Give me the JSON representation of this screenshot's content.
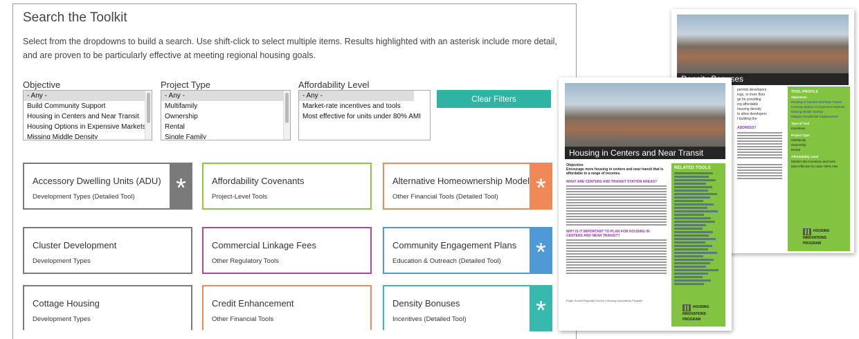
{
  "title": "Search the Toolkit",
  "intro": "Select from the dropdowns to build a search. Use shift-click to select multiple items. Results highlighted with an asterisk include more detail, and are proven to be particularly effective at meeting regional housing goals.",
  "filters": [
    {
      "label": "Objective",
      "options": [
        "- Any -",
        "Build Community Support",
        "Housing in Centers and Near Transit",
        "Housing Options in Expensive Markets",
        "Missing Middle Density"
      ]
    },
    {
      "label": "Project Type",
      "options": [
        "- Any -",
        "Multifamily",
        "Ownership",
        "Rental",
        "Single Family"
      ]
    },
    {
      "label": "Affordability Level",
      "options": [
        "- Any -",
        "Market-rate incentives and tools",
        "Most effective for units under 80% AMI"
      ]
    }
  ],
  "clear_label": "Clear Filters",
  "star_glyph": "*",
  "cards": [
    {
      "title": "Accessory Dwelling Units (ADU)",
      "subtitle": "Development Types (Detailed Tool)",
      "color": "#7a7a7a",
      "starred": true
    },
    {
      "title": "Affordability Covenants",
      "subtitle": "Project-Level Tools",
      "color": "#8dc641",
      "starred": false
    },
    {
      "title": "Alternative Homeownership Models",
      "subtitle": "Other Financial Tools (Detailed Tool)",
      "color": "#f08858",
      "starred": true
    },
    {
      "title": "Cluster Development",
      "subtitle": "Development Types",
      "color": "#7a7a7a",
      "starred": false
    },
    {
      "title": "Commercial Linkage Fees",
      "subtitle": "Other Regulatory Tools",
      "color": "#a44aa0",
      "starred": false
    },
    {
      "title": "Community Engagement Plans",
      "subtitle": "Education & Outreach (Detailed Tool)",
      "color": "#4f9ad6",
      "starred": true
    },
    {
      "title": "Cottage Housing",
      "subtitle": "Development Types",
      "color": "#7a7a7a",
      "starred": false
    },
    {
      "title": "Credit Enhancement",
      "subtitle": "Other Financial Tools",
      "color": "#f08858",
      "starred": false
    },
    {
      "title": "Density Bonuses",
      "subtitle": "Incentives (Detailed Tool)",
      "color": "#39b9ad",
      "starred": true
    }
  ],
  "doc_back": {
    "banner": "Density Bonuses",
    "profile_title": "TOOL PROFILE",
    "profile_lines": [
      "Objectives",
      "Housing in Centers and Near Transit",
      "Housing Options in Expensive Markets",
      "Missing Middle Density",
      "Mitigate Residential Displacement",
      "Type of Tool",
      "Incentives",
      "Project Type",
      "Multifamily",
      "Ownership",
      "Rental",
      "Affordability Level",
      "Market-rate incentives and tools",
      "Most effective for units <80% AMI"
    ],
    "text_snippets": [
      "permits developers",
      "ings, or more floor",
      "ge for providing",
      "ing affordable",
      "housing density",
      "to allow developers",
      "f building the",
      "ADDRESS?"
    ],
    "logo": "HOUSING INNOVATIONS PROGRAM"
  },
  "doc_front": {
    "banner": "Housing in Centers and Near Transit",
    "objective_heading": "Objective",
    "objective_text": "Encourage more housing in centers and near transit that is affordable to a range of incomes.",
    "section1": "WHAT ARE CENTERS AND TRANSIT STATION AREAS?",
    "section2": "WHY IS IT IMPORTANT TO PLAN FOR HOUSING IN CENTERS AND NEAR TRANSIT?",
    "related_title": "RELATED TOOLS",
    "footer": "Puget Sound Regional Council | Housing Innovations Program",
    "logo": "HOUSING INNOVATIONS PROGRAM"
  }
}
